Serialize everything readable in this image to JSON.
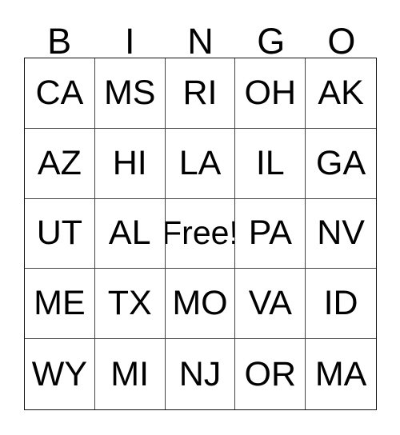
{
  "card": {
    "title": "BINGO",
    "header_letters": [
      "B",
      "I",
      "N",
      "G",
      "O"
    ],
    "free_space_label": "Free!",
    "background_color": "#ffffff",
    "text_color": "#000000",
    "grid_line_color": "#444444",
    "border_color": "#111111",
    "rows": [
      {
        "cells": [
          {
            "value": "CA"
          },
          {
            "value": "MS"
          },
          {
            "value": "RI"
          },
          {
            "value": "OH"
          },
          {
            "value": "AK"
          }
        ]
      },
      {
        "cells": [
          {
            "value": "AZ"
          },
          {
            "value": "HI"
          },
          {
            "value": "LA"
          },
          {
            "value": "IL"
          },
          {
            "value": "GA"
          }
        ]
      },
      {
        "cells": [
          {
            "value": "UT"
          },
          {
            "value": "AL"
          },
          {
            "value": "Free!"
          },
          {
            "value": "PA"
          },
          {
            "value": "NV"
          }
        ]
      },
      {
        "cells": [
          {
            "value": "ME"
          },
          {
            "value": "TX"
          },
          {
            "value": "MO"
          },
          {
            "value": "VA"
          },
          {
            "value": "ID"
          }
        ]
      },
      {
        "cells": [
          {
            "value": "WY"
          },
          {
            "value": "MI"
          },
          {
            "value": "NJ"
          },
          {
            "value": "OR"
          },
          {
            "value": "MA"
          }
        ]
      }
    ]
  }
}
